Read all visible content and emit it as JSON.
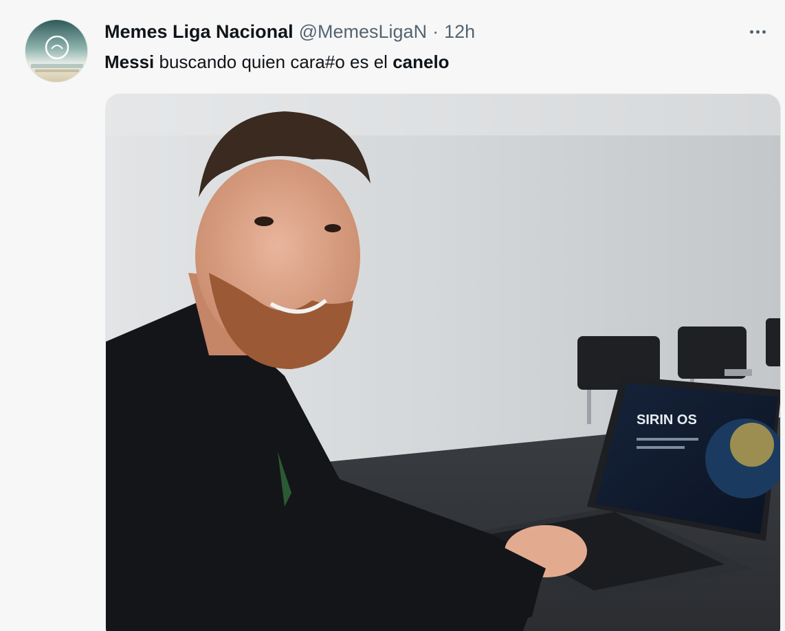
{
  "tweet": {
    "author": {
      "display_name": "Memes Liga Nacional",
      "handle": "@MemesLigaN",
      "separator": "·",
      "time": "12h"
    },
    "text_parts": {
      "bold_1": "Messi",
      "plain_1": " buscando quien cara#o es el ",
      "bold_2": "canelo"
    },
    "media": {
      "laptop_screen_brand": "SIRIN OS"
    },
    "more_icon": "more-horizontal-icon"
  },
  "colors": {
    "text_primary": "#0f1419",
    "text_secondary": "#536471",
    "background": "#f7f7f7"
  }
}
